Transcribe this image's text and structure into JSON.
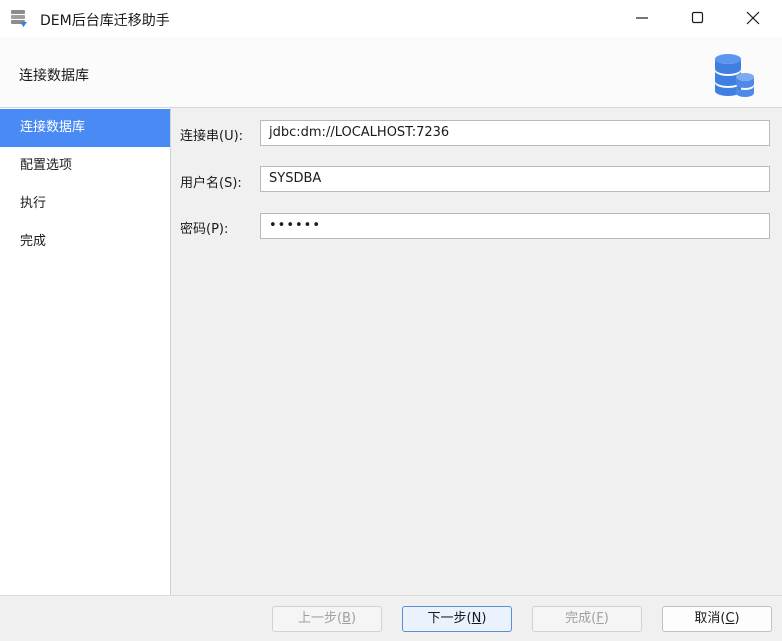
{
  "window": {
    "title": "DEM后台库迁移助手",
    "icon": "database-stack-icon"
  },
  "header": {
    "title": "连接数据库",
    "icon": "database-cylinders-icon"
  },
  "sidebar": {
    "items": [
      {
        "label": "连接数据库",
        "active": true
      },
      {
        "label": "配置选项",
        "active": false
      },
      {
        "label": "执行",
        "active": false
      },
      {
        "label": "完成",
        "active": false
      }
    ]
  },
  "form": {
    "connection_label": "连接串(U):",
    "connection_value": "jdbc:dm://LOCALHOST:7236",
    "username_label": "用户名(S):",
    "username_value": "SYSDBA",
    "password_label": "密码(P):",
    "password_value": "••••••"
  },
  "footer": {
    "prev": {
      "text": "上一步(",
      "key": "B",
      "tail": ")",
      "enabled": false
    },
    "next": {
      "text": "下一步(",
      "key": "N",
      "tail": ")",
      "enabled": true
    },
    "finish": {
      "text": "完成(",
      "key": "F",
      "tail": ")",
      "enabled": false
    },
    "cancel": {
      "text": "取消(",
      "key": "C",
      "tail": ")",
      "enabled": true
    }
  },
  "colors": {
    "accent": "#4a8af4",
    "icon_blue": "#3f7fe0"
  }
}
